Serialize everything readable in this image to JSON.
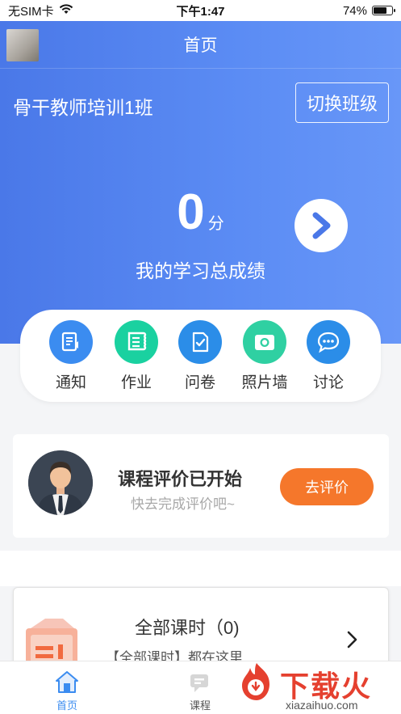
{
  "status_bar": {
    "carrier": "无SIM卡",
    "time": "下午1:47",
    "battery": "74%",
    "battery_level": 0.74
  },
  "header": {
    "title": "首页"
  },
  "class_info": {
    "name": "骨干教师培训1班",
    "switch_label": "切换班级"
  },
  "score": {
    "value": "0",
    "unit": "分",
    "label": "我的学习总成绩"
  },
  "quick_actions": [
    {
      "label": "通知",
      "icon": "notice-icon",
      "color": "#3b8cf0"
    },
    {
      "label": "作业",
      "icon": "homework-icon",
      "color": "#1ad1a0"
    },
    {
      "label": "问卷",
      "icon": "survey-icon",
      "color": "#2b8de8"
    },
    {
      "label": "照片墙",
      "icon": "camera-icon",
      "color": "#2fd0a2"
    },
    {
      "label": "讨论",
      "icon": "chat-icon",
      "color": "#2b8de8"
    }
  ],
  "evaluation": {
    "title": "课程评价已开始",
    "subtitle": "快去完成评价吧~",
    "button": "去评价",
    "button_color": "#f5772b"
  },
  "lessons": {
    "title": "全部课时（0)",
    "subtitle": "【全部课时】都在这里"
  },
  "tabbar": {
    "items": [
      {
        "label": "首页",
        "active": true
      },
      {
        "label": "课程",
        "active": false
      }
    ]
  },
  "watermark": {
    "text": "下载火",
    "domain": "xiazaihuo.com"
  },
  "colors": {
    "primary": "#4a78e8",
    "accent": "#f5772b",
    "active_tab": "#3b8cf0"
  }
}
